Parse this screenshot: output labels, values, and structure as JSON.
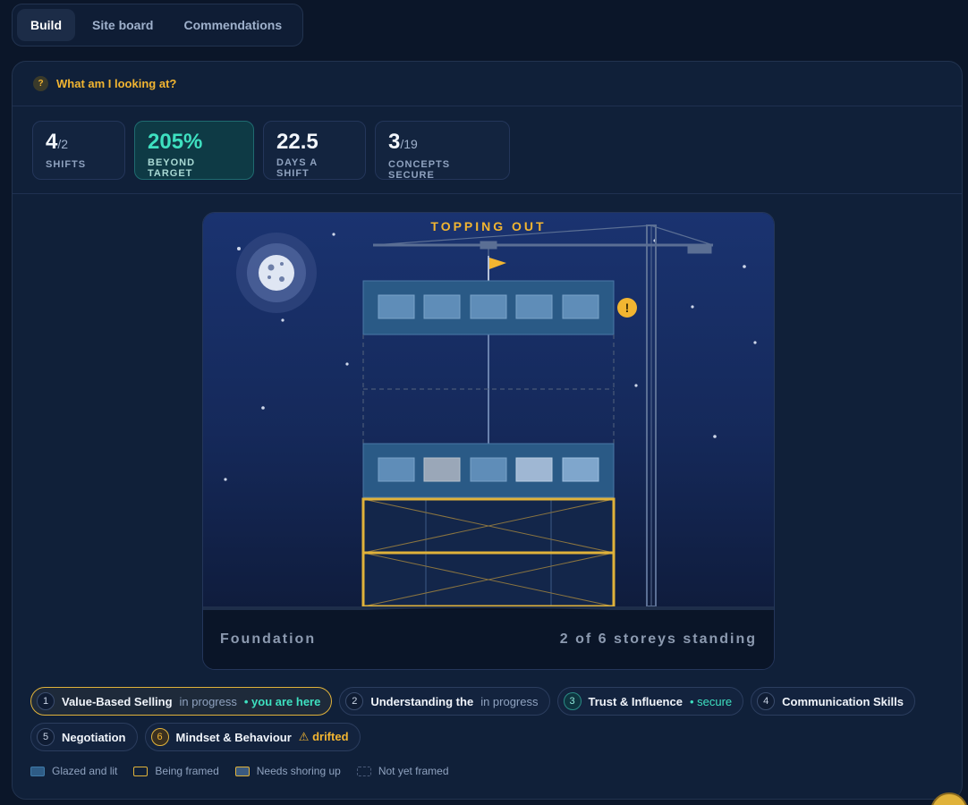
{
  "tabs": [
    {
      "label": "Build",
      "active": true
    },
    {
      "label": "Site board",
      "active": false
    },
    {
      "label": "Commendations",
      "active": false
    }
  ],
  "help": {
    "badge": "?",
    "text": "What am I looking at?"
  },
  "stats": [
    {
      "value": "4",
      "sub": "/2",
      "label": "SHIFTS"
    },
    {
      "value": "205%",
      "sub": "",
      "label": "BEYOND TARGET"
    },
    {
      "value": "22.5",
      "sub": "",
      "label": "DAYS A SHIFT"
    },
    {
      "value": "3",
      "sub": "/19",
      "label": "CONCEPTS SECURE"
    }
  ],
  "scene": {
    "title": "TOPPING OUT",
    "footer_left": "Foundation",
    "footer_right": "2 of 6 storeys standing",
    "alert_glyph": "!"
  },
  "concepts": [
    {
      "num": "1",
      "label": "Value-Based Selling",
      "status": "in progress",
      "extra": "• you are here"
    },
    {
      "num": "2",
      "label": "Understanding the",
      "status": "in progress",
      "extra": ""
    },
    {
      "num": "3",
      "label": "Trust & Influence",
      "status": "• secure",
      "extra": ""
    },
    {
      "num": "4",
      "label": "Communication Skills",
      "status": "",
      "extra": ""
    },
    {
      "num": "5",
      "label": "Negotiation",
      "status": "",
      "extra": ""
    },
    {
      "num": "6",
      "label": "Mindset & Behaviour",
      "status": "⚠ drifted",
      "extra": ""
    }
  ],
  "legend": [
    {
      "label": "Glazed and lit"
    },
    {
      "label": "Being framed"
    },
    {
      "label": "Needs shoring up"
    },
    {
      "label": "Not yet framed"
    }
  ],
  "colors": {
    "accent_amber": "#f2b531",
    "accent_teal": "#3ee0c0",
    "background": "#0b1629"
  }
}
